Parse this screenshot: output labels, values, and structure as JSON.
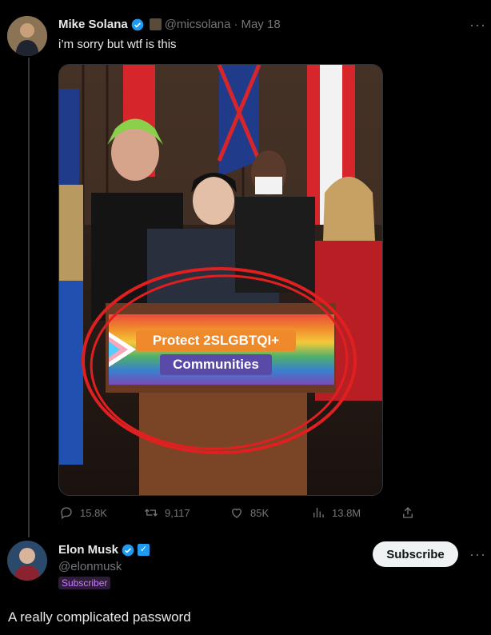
{
  "tweet": {
    "author_name": "Mike Solana",
    "handle": "@micsolana",
    "date": "May 18",
    "text": "i’m sorry but wtf is this",
    "media": {
      "banner_line1": "Protect 2SLGBTQI+",
      "banner_line2": "Communities"
    },
    "actions": {
      "replies": "15.8K",
      "retweets": "9,117",
      "likes": "85K",
      "views": "13.8M"
    }
  },
  "reply": {
    "author_name": "Elon Musk",
    "handle": "@elonmusk",
    "badge": "Subscriber",
    "subscribe_label": "Subscribe",
    "text": "A really complicated password"
  },
  "colors": {
    "background": "#000000",
    "text": "#e7e9ea",
    "muted": "#71767b",
    "verified": "#1d9bf0"
  }
}
